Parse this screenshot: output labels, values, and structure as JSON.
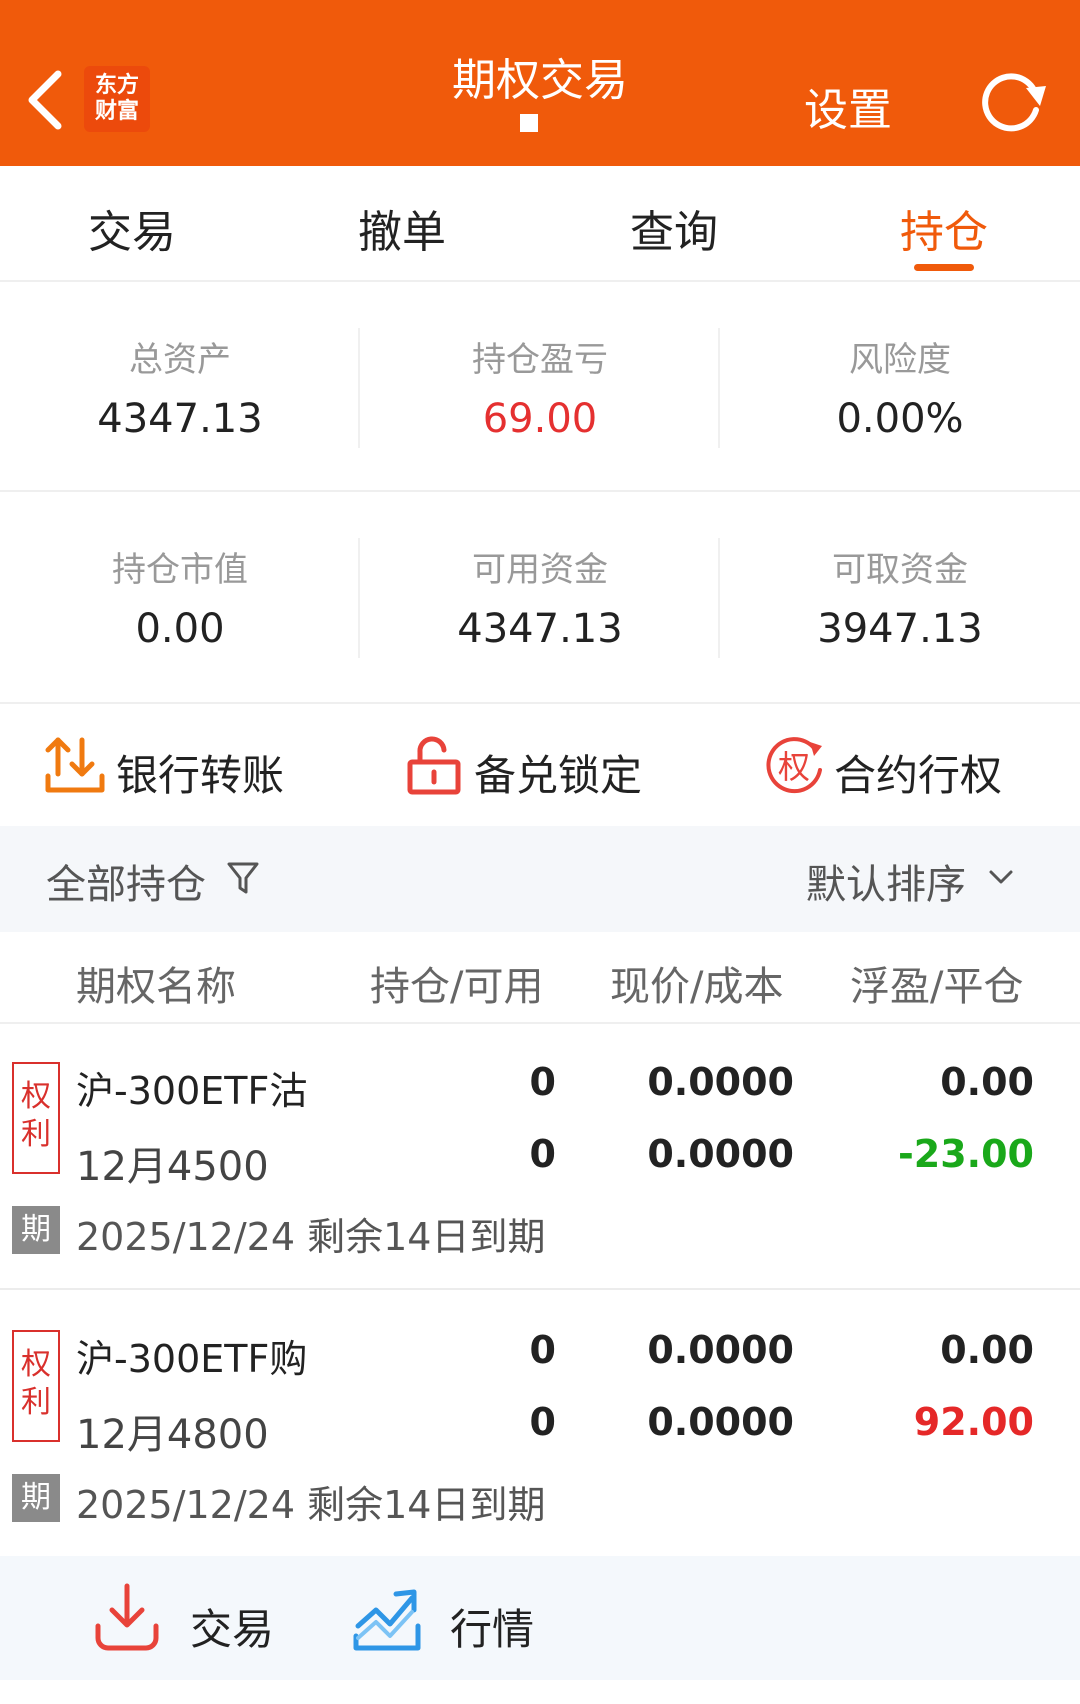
{
  "header": {
    "title": "期权交易",
    "settings_label": "设置",
    "logo_line1": "东方",
    "logo_line2": "财富"
  },
  "tabs": [
    {
      "label": "交易",
      "active": false
    },
    {
      "label": "撤单",
      "active": false
    },
    {
      "label": "查询",
      "active": false
    },
    {
      "label": "持仓",
      "active": true
    }
  ],
  "summary": {
    "row1": [
      {
        "label": "总资产",
        "value": "4347.13"
      },
      {
        "label": "持仓盈亏",
        "value": "69.00"
      },
      {
        "label": "风险度",
        "value": "0.00%"
      }
    ],
    "row2": [
      {
        "label": "持仓市值",
        "value": "0.00"
      },
      {
        "label": "可用资金",
        "value": "4347.13"
      },
      {
        "label": "可取资金",
        "value": "3947.13"
      }
    ]
  },
  "actions": [
    {
      "label": "银行转账",
      "icon": "bank-transfer-icon"
    },
    {
      "label": "备兑锁定",
      "icon": "unlock-icon"
    },
    {
      "label": "合约行权",
      "icon": "exercise-icon",
      "icon_text": "权"
    }
  ],
  "filter": {
    "label": "全部持仓",
    "sort_label": "默认排序"
  },
  "table": {
    "headers": [
      "期权名称",
      "持仓/可用",
      "现价/成本",
      "浮盈/平仓"
    ],
    "rows": [
      {
        "tag": [
          "权",
          "利"
        ],
        "name": "沪-300ETF沽",
        "sub": "12月4500",
        "position": "0",
        "available": "0",
        "price": "0.0000",
        "cost": "0.0000",
        "float_pl": "0.00",
        "close_pl": "-23.00",
        "expiry_badge": "期",
        "expiry": "2025/12/24 剩余14日到期"
      },
      {
        "tag": [
          "权",
          "利"
        ],
        "name": "沪-300ETF购",
        "sub": "12月4800",
        "position": "0",
        "available": "0",
        "price": "0.0000",
        "cost": "0.0000",
        "float_pl": "0.00",
        "close_pl": "92.00",
        "expiry_badge": "期",
        "expiry": "2025/12/24 剩余14日到期"
      }
    ]
  },
  "bottom": [
    {
      "label": "交易",
      "icon": "download-icon"
    },
    {
      "label": "行情",
      "icon": "chart-trend-icon"
    }
  ],
  "colors": {
    "brand": "#f05a0b",
    "gain": "#e52828",
    "loss": "#1aa81a"
  }
}
